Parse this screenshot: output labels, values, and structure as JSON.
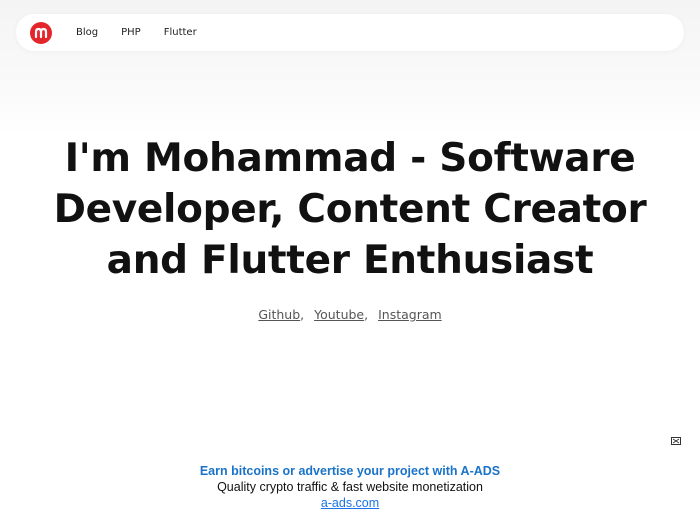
{
  "nav": {
    "logo_alt": "m",
    "links": [
      "Blog",
      "PHP",
      "Flutter"
    ]
  },
  "hero": {
    "title_lines": [
      "I'm Mohammad - Software",
      "Developer, Content Creator",
      "and Flutter Enthusiast"
    ]
  },
  "social": {
    "links": [
      "Github",
      "Youtube",
      "Instagram"
    ],
    "separator": ","
  },
  "ad": {
    "headline": "Earn bitcoins or advertise your project with A-ADS",
    "description": "Quality crypto traffic & fast website monetization",
    "url": "a-ads.com",
    "close_icon": "ad-choices-icon"
  },
  "colors": {
    "brand": "#e3262c",
    "ad_headline": "#1a73c8",
    "link": "#1a73e8"
  }
}
